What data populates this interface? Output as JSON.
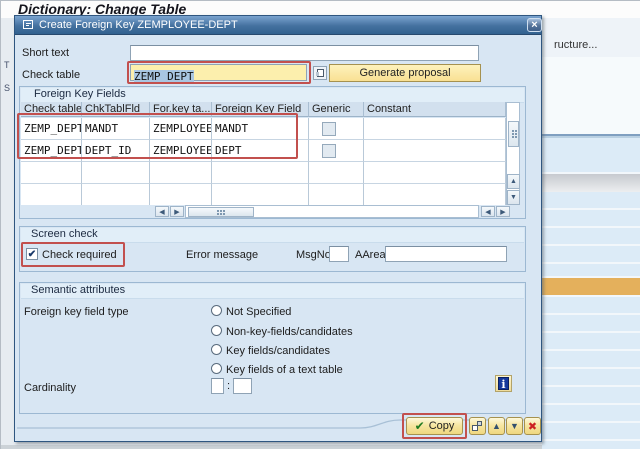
{
  "page": {
    "title": "Dictionary: Change Table",
    "partial_structure_button": "ructure...",
    "left_edge_fragments": {
      "f1": "T",
      "f2": "S"
    }
  },
  "dialog": {
    "title": "Create Foreign Key ZEMPLOYEE-DEPT",
    "short_text": {
      "label": "Short text",
      "value": ""
    },
    "check_table": {
      "label": "Check table",
      "value": "ZEMP_DEPT"
    },
    "generate_proposal_button": "Generate proposal",
    "foreign_key_fields": {
      "title": "Foreign Key Fields",
      "columns": [
        "Check table",
        "ChkTablFld",
        "For.key ta...",
        "Foreign Key Field",
        "Generic",
        "Constant"
      ],
      "rows": [
        {
          "check_table": "ZEMP_DEPT",
          "chk_tabl_fld": "MANDT",
          "for_key_table": "ZEMPLOYEE",
          "foreign_key_field": "MANDT",
          "generic_checked": false,
          "constant": ""
        },
        {
          "check_table": "ZEMP_DEPT",
          "chk_tabl_fld": "DEPT_ID",
          "for_key_table": "ZEMPLOYEE",
          "foreign_key_field": "DEPT",
          "generic_checked": false,
          "constant": ""
        }
      ]
    },
    "screen_check": {
      "title": "Screen check",
      "check_required_label": "Check required",
      "check_required_checked": true,
      "check_mark": "✔",
      "error_message_label": "Error message",
      "msgno_label": "MsgNo",
      "msgno_value": "",
      "aarea_label": "AArea",
      "aarea_value": ""
    },
    "semantic_attributes": {
      "title": "Semantic attributes",
      "fk_type_label": "Foreign key field type",
      "options": [
        "Not Specified",
        "Non-key-fields/candidates",
        "Key fields/candidates",
        "Key fields of a text table"
      ],
      "selected_option": "Not Specified",
      "cardinality_label": "Cardinality",
      "cardinality_left": "",
      "cardinality_separator": ":",
      "cardinality_right": "",
      "info_icon_glyph": "i"
    },
    "footer": {
      "copy_check_glyph": "✔",
      "copy_button": "Copy",
      "up_glyph": "▲",
      "down_glyph": "▼",
      "cancel_glyph": "✖"
    },
    "close_glyph": "×"
  },
  "colors": {
    "annotation_red": "#c2504e",
    "check_table_yellow": "#fcefad",
    "selection_blue": "#a9c6e2",
    "button_yellow": "#f6e6a2",
    "orange_row": "#e4b05c",
    "titlebar_blue": "#3a689e"
  }
}
